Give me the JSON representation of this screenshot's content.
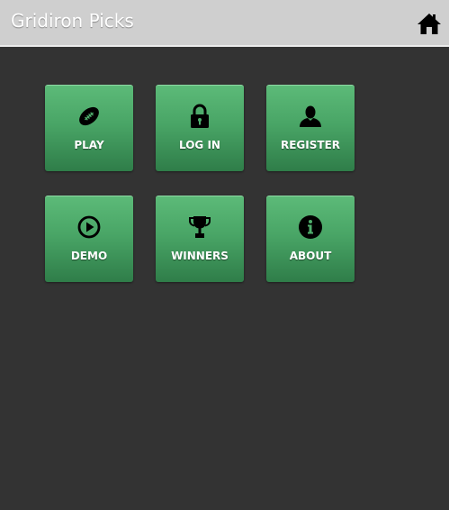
{
  "app": {
    "title": "Gridiron Picks",
    "home_icon": "home-icon"
  },
  "tiles": [
    {
      "label": "PLAY",
      "icon": "football-icon"
    },
    {
      "label": "LOG IN",
      "icon": "lock-icon"
    },
    {
      "label": "REGISTER",
      "icon": "user-icon"
    },
    {
      "label": "DEMO",
      "icon": "play-circle-icon"
    },
    {
      "label": "WINNERS",
      "icon": "trophy-icon"
    },
    {
      "label": "ABOUT",
      "icon": "info-icon"
    }
  ],
  "colors": {
    "background": "#333333",
    "header": "#cfcfcf",
    "tile_top": "#5cba78",
    "tile_bottom": "#2f7d49",
    "icon": "#000000",
    "label": "#ffffff"
  }
}
